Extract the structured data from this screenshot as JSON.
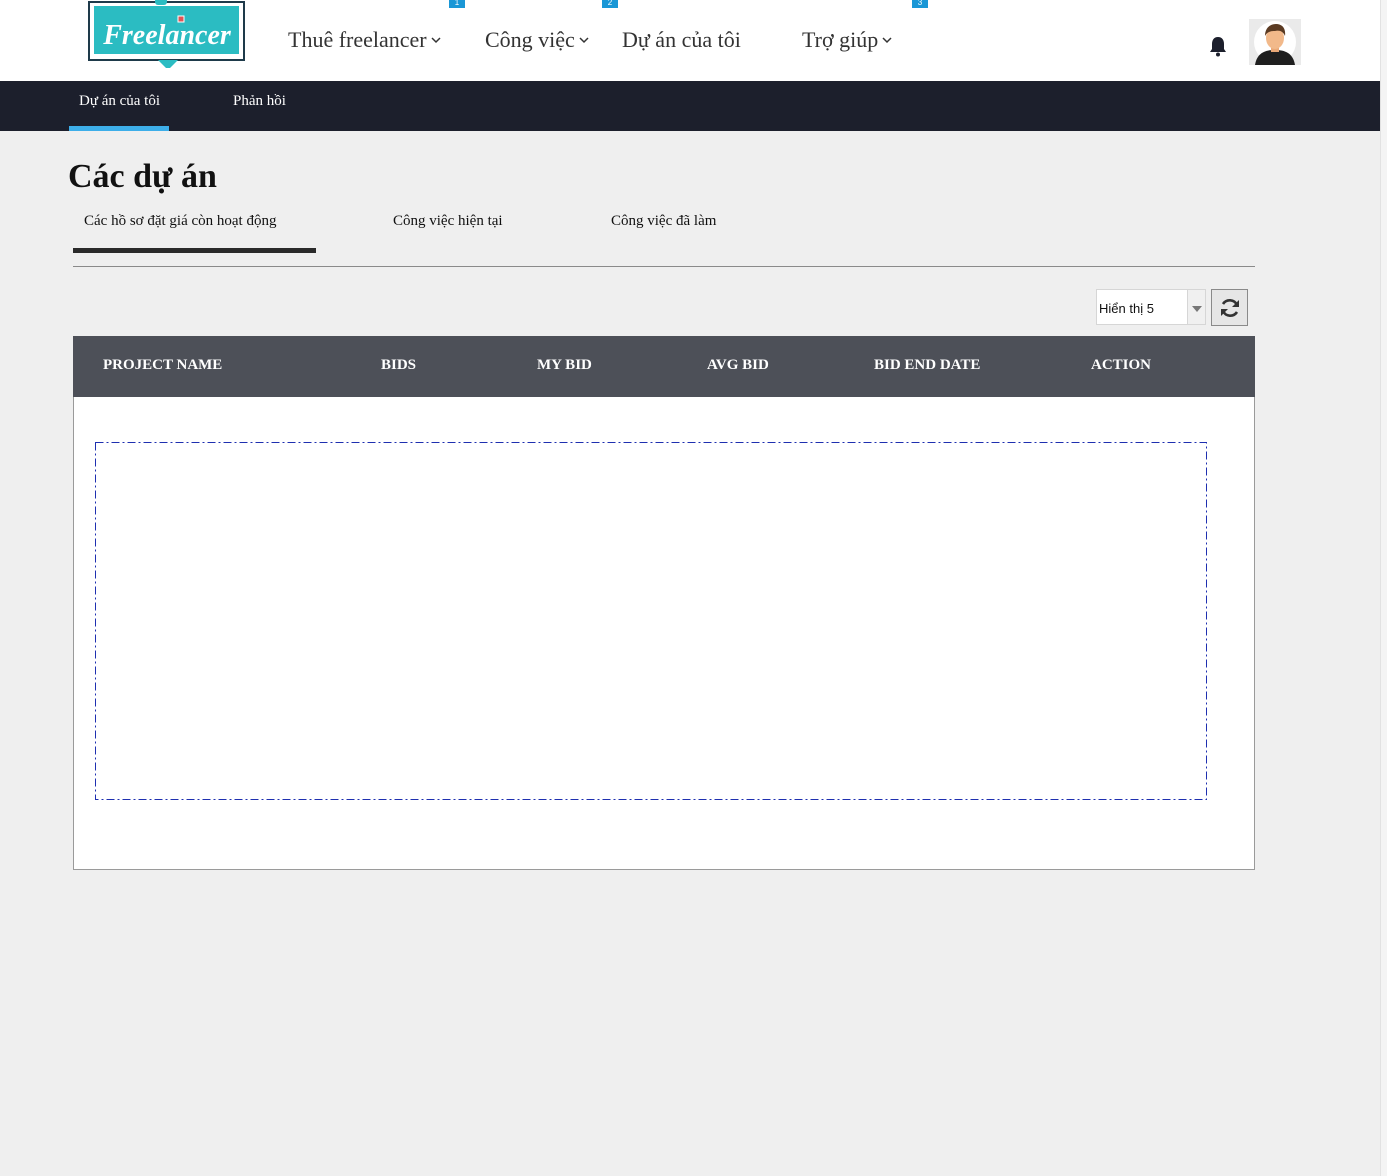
{
  "header": {
    "logo_text": "Freelancer",
    "nav": [
      {
        "label": "Thuê freelancer",
        "has_dropdown": true
      },
      {
        "label": "Công việc",
        "has_dropdown": true
      },
      {
        "label": "Dự án của tôi",
        "has_dropdown": false
      },
      {
        "label": "Trợ giúp",
        "has_dropdown": true
      }
    ],
    "markers": [
      "1",
      "2",
      "3"
    ],
    "bell_icon": "bell-icon",
    "avatar_icon": "user-avatar-icon"
  },
  "subnav": {
    "items": [
      {
        "label": "Dự án của tôi",
        "active": true
      },
      {
        "label": "Phản hồi",
        "active": false
      }
    ]
  },
  "page": {
    "title": "Các dự án",
    "tabs": [
      {
        "label": "Các hồ sơ đặt giá còn hoạt động",
        "active": true
      },
      {
        "label": "Công việc hiện tại",
        "active": false
      },
      {
        "label": "Công việc đã làm",
        "active": false
      }
    ]
  },
  "toolbar": {
    "page_size_value": "Hiển thị 5",
    "refresh_icon": "refresh-icon"
  },
  "table": {
    "columns": [
      "PROJECT NAME",
      "BIDS",
      "MY BID",
      "AVG BID",
      "BID END DATE",
      "ACTION"
    ],
    "rows": []
  },
  "colors": {
    "accent": "#3daee9",
    "logo_teal": "#2bbcc2",
    "subnav_bg": "#1c1f2c",
    "table_header_bg": "#4d5058"
  }
}
